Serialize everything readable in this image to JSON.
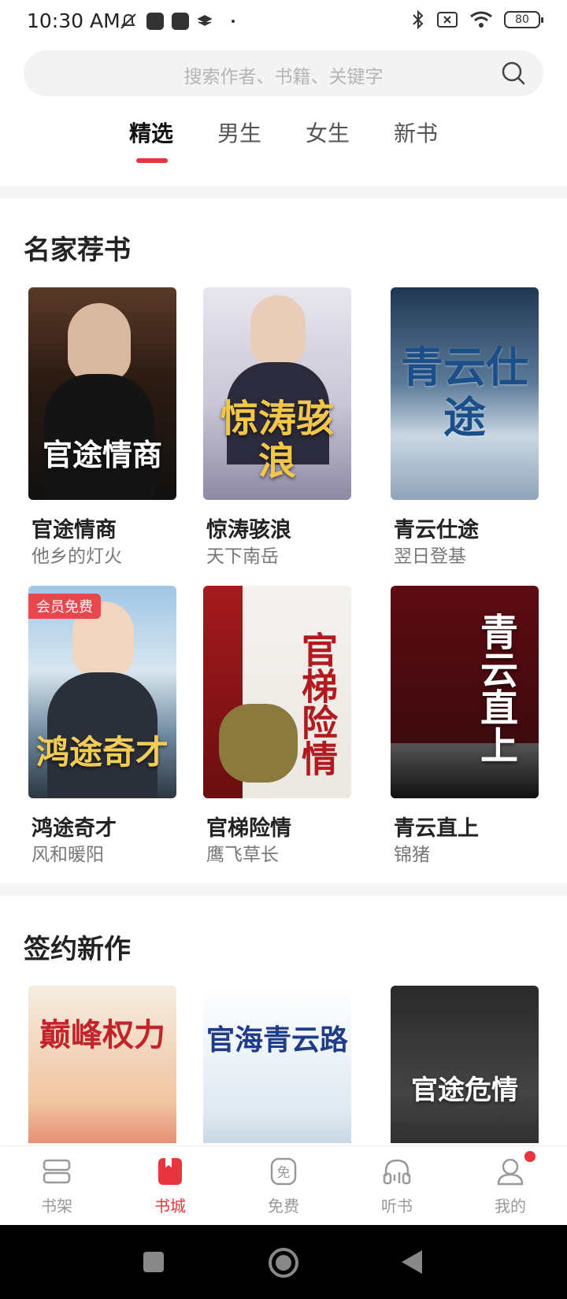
{
  "status": {
    "time": "10:30 AM",
    "battery": "80"
  },
  "search": {
    "placeholder": "搜索作者、书籍、关键字"
  },
  "tabs": [
    {
      "label": "精选",
      "active": true
    },
    {
      "label": "男生",
      "active": false
    },
    {
      "label": "女生",
      "active": false
    },
    {
      "label": "新书",
      "active": false
    }
  ],
  "sections": [
    {
      "title": "名家荐书",
      "books": [
        {
          "title": "官途情商",
          "author": "他乡的灯火",
          "cover_text": "官途情商",
          "badge": ""
        },
        {
          "title": "惊涛骇浪",
          "author": "天下南岳",
          "cover_text": "惊涛骇浪",
          "badge": ""
        },
        {
          "title": "青云仕途",
          "author": "翌日登基",
          "cover_text": "青云仕途",
          "badge": ""
        },
        {
          "title": "鸿途奇才",
          "author": "风和暖阳",
          "cover_text": "鸿途奇才",
          "badge": "会员免费"
        },
        {
          "title": "官梯险情",
          "author": "鹰飞草长",
          "cover_text": "官梯险情",
          "badge": ""
        },
        {
          "title": "青云直上",
          "author": "锦猪",
          "cover_text": "青云直上",
          "badge": ""
        }
      ]
    },
    {
      "title": "签约新作",
      "books": [
        {
          "cover_text": "巅峰权力"
        },
        {
          "cover_text": "官海青云路"
        },
        {
          "cover_text": "官途危情"
        }
      ]
    }
  ],
  "bottom_nav": [
    {
      "label": "书架",
      "icon": "bookshelf-icon"
    },
    {
      "label": "书城",
      "icon": "bookstore-icon",
      "active": true
    },
    {
      "label": "免费",
      "icon": "free-icon"
    },
    {
      "label": "听书",
      "icon": "headphones-icon"
    },
    {
      "label": "我的",
      "icon": "profile-icon"
    }
  ],
  "colors": {
    "accent": "#e8343c",
    "text_primary": "#222222",
    "text_secondary": "#777777"
  }
}
